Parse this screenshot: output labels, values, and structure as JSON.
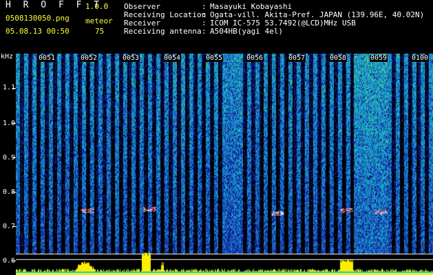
{
  "header": {
    "app_title": "H R O F F T",
    "version": "1.0.0",
    "filename": "0508130050.png",
    "meteor_label": "meteor",
    "datetime": "05.08.13 00:50",
    "meteor_count": "75",
    "info": [
      {
        "label": "Observer",
        "value": "Masayuki Kobayashi"
      },
      {
        "label": "Receiving Location",
        "value": "Ogata-vill. Akita-Pref. JAPAN (139.96E, 40.02N)"
      },
      {
        "label": "Receiver",
        "value": "ICOM IC-575 53.7492(@LCD)MHz USB"
      },
      {
        "label": "Receiving antenna",
        "value": "A504HB(yagi 4el)"
      }
    ]
  },
  "spectrogram": {
    "y_unit": "kHz",
    "y_labels": [
      "1.1",
      "1.0",
      "0.9",
      "0.8",
      "0.7",
      "0.6"
    ],
    "minute_labels": [
      "0051",
      "0052",
      "0053",
      "0054",
      "0055",
      "0056",
      "0057",
      "0058",
      "0059",
      "0100"
    ],
    "colors": {
      "background": "#000000",
      "noise_low": "#0a1e8c",
      "noise_mid": "#1e64c8",
      "noise_high": "#28c8a0",
      "meteor": "#ff3333",
      "level": "#ffee00",
      "level_base": "#00c8ff",
      "marker_line": "#ffffff"
    }
  }
}
